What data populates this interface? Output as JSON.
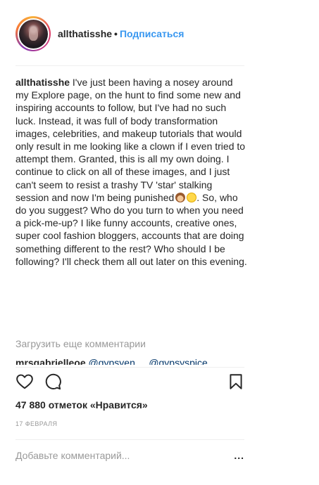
{
  "header": {
    "username": "allthatisshe",
    "separator": "•",
    "follow_label": "Подписаться"
  },
  "caption": {
    "username": "allthatisshe",
    "text_part1": "I've just been having a nosey around my Explore page, on the hunt to find some new and inspiring accounts to follow, but I've had no such luck. Instead, it was full of body transformation images, celebrities, and makeup tutorials that would only result in me looking like a clown if I even tried to attempt them. Granted, this is all my own doing. I continue to click on all of these images, and I just can't seem to resist a trashy TV 'star' stalking session and now I'm being punished",
    "emoji1": "see-no-evil-monkey",
    "emoji2": "face-with-tears-of-joy",
    "text_part2": ". So, who do you suggest? Who do you turn to when you need a pick-me-up? I like funny accounts, creative ones, super cool fashion bloggers, accounts that are doing something different to the rest? Who should I be following? I'll check them all out later on this evening."
  },
  "comments": {
    "load_more_label": "Загрузить еще комментарии",
    "peek": {
      "username": "mrsgabrielleoe",
      "mention1": "@gypsyen",
      "mention2": "@gypsyspice"
    }
  },
  "actions": {
    "like_icon": "heart-outline-icon",
    "comment_icon": "comment-bubble-icon",
    "save_icon": "bookmark-outline-icon"
  },
  "likes_text": "47 880 отметок «Нравится»",
  "date_text": "17 ФЕВРАЛЯ",
  "comment_input": {
    "placeholder": "Добавьте комментарий...",
    "more_label": "..."
  },
  "colors": {
    "text": "#262626",
    "link": "#3897f0",
    "muted": "#999999",
    "divider": "#efefef"
  }
}
